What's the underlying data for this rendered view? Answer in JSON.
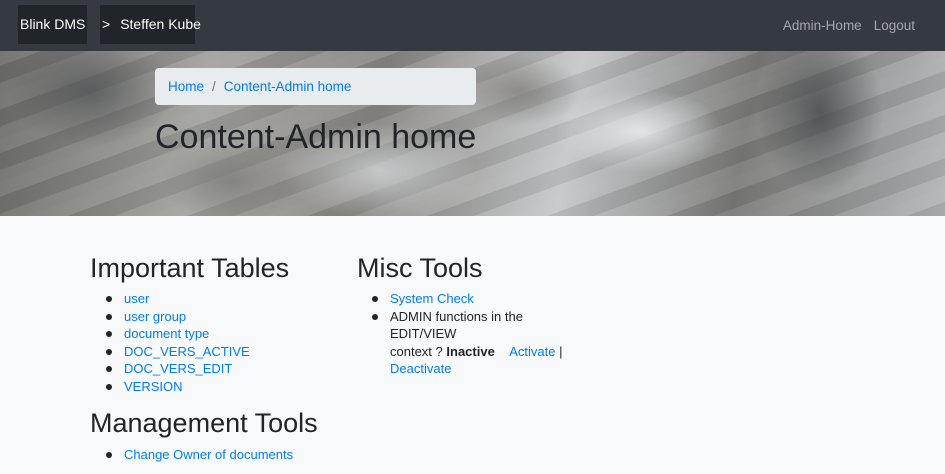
{
  "navbar": {
    "brand": "Blink DMS",
    "separator": ">",
    "user": "Steffen Kube",
    "links": [
      "Admin-Home",
      "Logout"
    ]
  },
  "hero": {
    "breadcrumb": [
      "Home",
      "/",
      "Content-Admin home"
    ],
    "title": "Content-Admin home"
  },
  "important_tables": {
    "title": "Important Tables",
    "items": [
      "user",
      "user group",
      "document type",
      "DOC_VERS_ACTIVE",
      "DOC_VERS_EDIT",
      "VERSION"
    ]
  },
  "misc_tools": {
    "title": "Misc Tools",
    "system_check": "System Check",
    "admin_text_1": "ADMIN functions in the EDIT/VIEW",
    "admin_text_2": "context ?",
    "status": "Inactive",
    "activate": "Activate",
    "pipe": "|",
    "deactivate": "Deactivate"
  },
  "management_tools": {
    "title": "Management Tools",
    "items": [
      "Change Owner of documents"
    ]
  }
}
